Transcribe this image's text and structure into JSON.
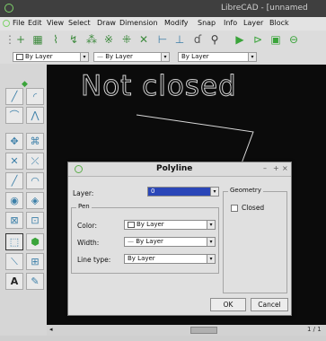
{
  "window": {
    "title": "LibreCAD - [unnamed"
  },
  "menu": [
    "File",
    "Edit",
    "View",
    "Select",
    "Draw",
    "Dimension",
    "Modify",
    "Snap",
    "Info",
    "Layer",
    "Block"
  ],
  "pen_toolbar": {
    "color": "By Layer",
    "width": "By Layer",
    "line_type": "By Layer"
  },
  "canvas": {
    "annotation": "Not closed"
  },
  "statusbar": {
    "page_label": "1 / 1"
  },
  "dialog": {
    "title": "Polyline",
    "layer_label": "Layer:",
    "layer_value": "0",
    "pen_group": "Pen",
    "color_label": "Color:",
    "color_value": "By Layer",
    "width_label": "Width:",
    "width_value": "By Layer",
    "linetype_label": "Line type:",
    "linetype_value": "By Layer",
    "geometry_group": "Geometry",
    "closed_label": "Closed",
    "closed_checked": false,
    "ok_label": "OK",
    "cancel_label": "Cancel"
  },
  "colors": {
    "canvas_bg": "#0b0b0b",
    "accent_green": "#3d8a3d",
    "selection_blue": "#2a46b8"
  }
}
